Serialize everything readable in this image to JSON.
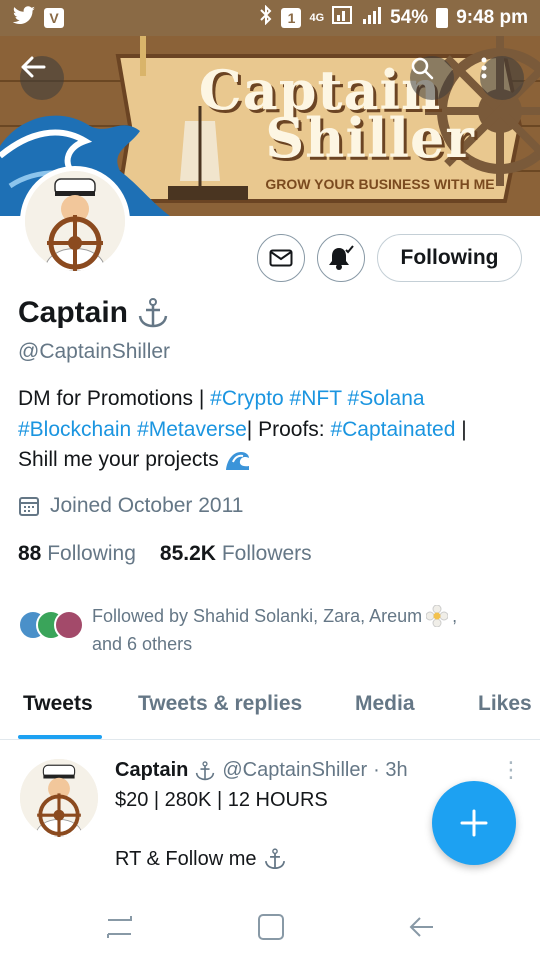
{
  "status_bar": {
    "time": "9:48 pm",
    "battery": "54%",
    "network": "4G",
    "sim": "1",
    "icons": [
      "twitter-icon",
      "v-app-icon",
      "bluetooth-icon",
      "sim-icon",
      "network-icon",
      "signal-icon",
      "battery-icon"
    ]
  },
  "banner": {
    "title_line1": "Captain",
    "title_line2": "Shiller",
    "tagline": "GROW YOUR BUSINESS WITH ME"
  },
  "profile": {
    "name": "Captain",
    "handle": "@CaptainShiller",
    "following_button": "Following",
    "bio": {
      "line1_prefix": "DM for Promotions | ",
      "line1_tags": [
        "#Crypto",
        "#NFT",
        "#Solana"
      ],
      "line2_tags": [
        "#Blockchain",
        "#Metaverse"
      ],
      "line2_text": "| Proofs: ",
      "line2_tag_end": "#Captainated",
      "line2_suffix": " |",
      "line3": "Shill me your projects"
    },
    "joined": "Joined October 2011",
    "following_count": "88",
    "following_label": "Following",
    "followers_count": "85.2K",
    "followers_label": "Followers",
    "followed_by_line1": "Followed by Shahid Solanki, Zara, Areum",
    "followed_by_line2": "and 6 others"
  },
  "tabs": [
    "Tweets",
    "Tweets & replies",
    "Media",
    "Likes"
  ],
  "tweet": {
    "name": "Captain",
    "handle": "@CaptainShiller",
    "time": "· 3h",
    "line1": "$20 | 280K | 12 HOURS",
    "line2": "RT & Follow me"
  },
  "colors": {
    "accent": "#1da1f2",
    "link": "#1b95e0",
    "secondary_text": "#657786",
    "status_bar": "#8a6a45"
  }
}
